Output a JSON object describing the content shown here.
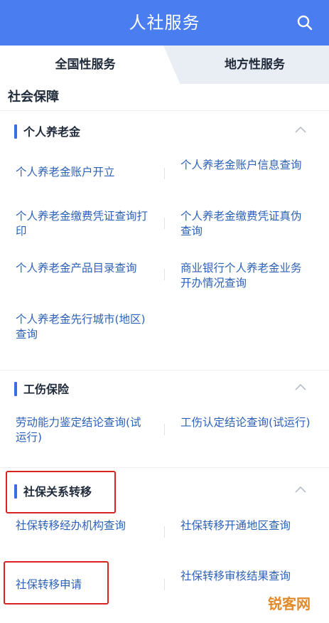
{
  "header": {
    "title": "人社服务",
    "search_icon": "search-icon"
  },
  "tabs": [
    {
      "label": "全国性服务",
      "active": true
    },
    {
      "label": "地方性服务",
      "active": false
    }
  ],
  "page_title": "社会保障",
  "sections": [
    {
      "title": "个人养老金",
      "items": [
        "个人养老金账户开立",
        "个人养老金账户信息查询",
        "个人养老金缴费凭证查询打印",
        "个人养老金缴费凭证真伪查询",
        "个人养老金产品目录查询",
        "商业银行个人养老金业务开办情况查询",
        "个人养老金先行城市(地区)查询"
      ]
    },
    {
      "title": "工伤保险",
      "items": [
        "劳动能力鉴定结论查询(试运行)",
        "工伤认定结论查询(试运行)"
      ]
    },
    {
      "title": "社保关系转移",
      "items": [
        "社保转移经办机构查询",
        "社保转移开通地区查询",
        "社保转移申请",
        "社保转移审核结果查询"
      ]
    }
  ],
  "watermark": "锐客网",
  "colors": {
    "brand": "#4a7df0",
    "link": "#2e62b8",
    "highlight": "#d9231f"
  }
}
